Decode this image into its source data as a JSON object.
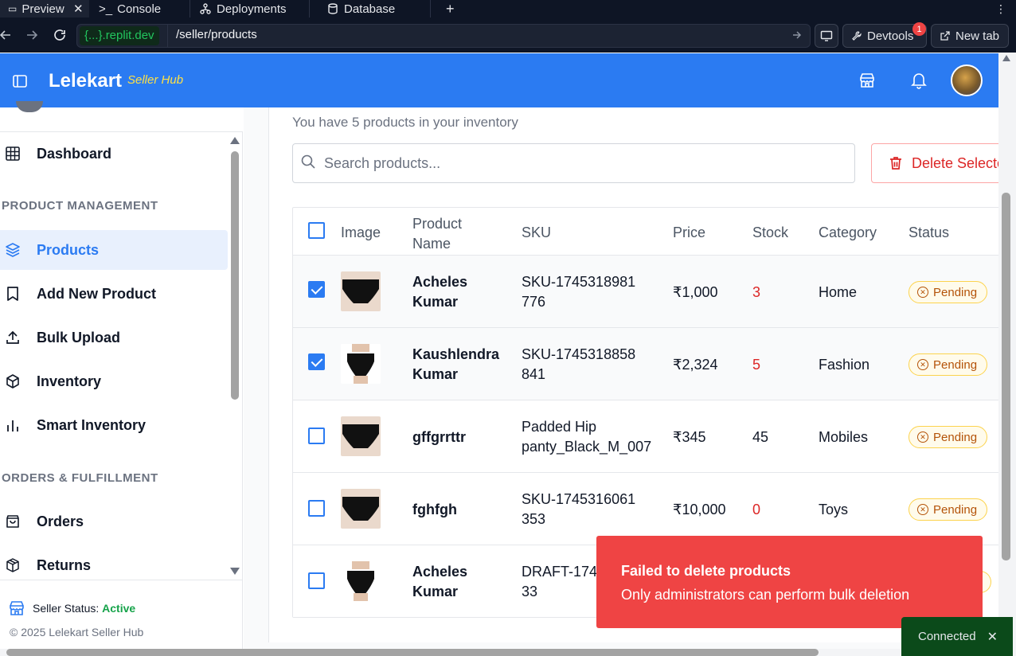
{
  "browser": {
    "tabs": [
      {
        "label": "Preview",
        "icon": "preview-icon"
      },
      {
        "label": "Console",
        "icon": "console-icon"
      },
      {
        "label": "Deployments",
        "icon": "deployments-icon"
      },
      {
        "label": "Database",
        "icon": "database-icon"
      }
    ],
    "url_host": "{...}.replit.dev",
    "url_path": "/seller/products",
    "devtools_label": "Devtools",
    "devtools_badge": "1",
    "new_tab_label": "New tab"
  },
  "header": {
    "brand": "Lelekart",
    "brand_sub": "Seller Hub"
  },
  "sidebar": {
    "dashboard": "Dashboard",
    "section_product": "PRODUCT MANAGEMENT",
    "items": [
      {
        "label": "Products",
        "icon": "layers-icon"
      },
      {
        "label": "Add New Product",
        "icon": "bookmark-icon"
      },
      {
        "label": "Bulk Upload",
        "icon": "upload-icon"
      },
      {
        "label": "Inventory",
        "icon": "box-icon"
      },
      {
        "label": "Smart Inventory",
        "icon": "bar-chart-icon"
      }
    ],
    "section_orders": "ORDERS & FULFILLMENT",
    "orders": "Orders",
    "returns": "Returns",
    "status_label": "Seller Status:",
    "status_value": "Active",
    "copyright": "© 2025 Lelekart Seller Hub"
  },
  "main": {
    "subtitle": "You have 5 products in your inventory",
    "search_placeholder": "Search products...",
    "delete_label": "Delete Selected",
    "columns": [
      "Image",
      "Product Name",
      "SKU",
      "Price",
      "Stock",
      "Category",
      "Status"
    ],
    "rows": [
      {
        "name": "Acheles Kumar",
        "sku": "SKU-1745318981776",
        "price": "₹1,000",
        "stock": "3",
        "category": "Home",
        "status": "Pending",
        "checked": true
      },
      {
        "name": "Kaushlendra Kumar",
        "sku": "SKU-1745318858841",
        "price": "₹2,324",
        "stock": "5",
        "category": "Fashion",
        "status": "Pending",
        "checked": true
      },
      {
        "name": "gffgrrttr",
        "sku": "Padded Hip panty_Black_M_007",
        "price": "₹345",
        "stock": "45",
        "category": "Mobiles",
        "status": "Pending",
        "checked": false
      },
      {
        "name": "fghfgh",
        "sku": "SKU-1745316061353",
        "price": "₹10,000",
        "stock": "0",
        "category": "Toys",
        "status": "Pending",
        "checked": false
      },
      {
        "name": "Acheles Kumar",
        "sku": "DRAFT-1745301133",
        "price": "",
        "stock": "",
        "category": "",
        "status": "",
        "checked": false
      }
    ]
  },
  "toast": {
    "title": "Failed to delete products",
    "message": "Only administrators can perform bulk deletion"
  },
  "connection": {
    "label": "Connected"
  },
  "colors": {
    "accent": "#2b7bf2",
    "danger": "#ef4444",
    "pending": "#b45309",
    "active": "#16a34a"
  }
}
